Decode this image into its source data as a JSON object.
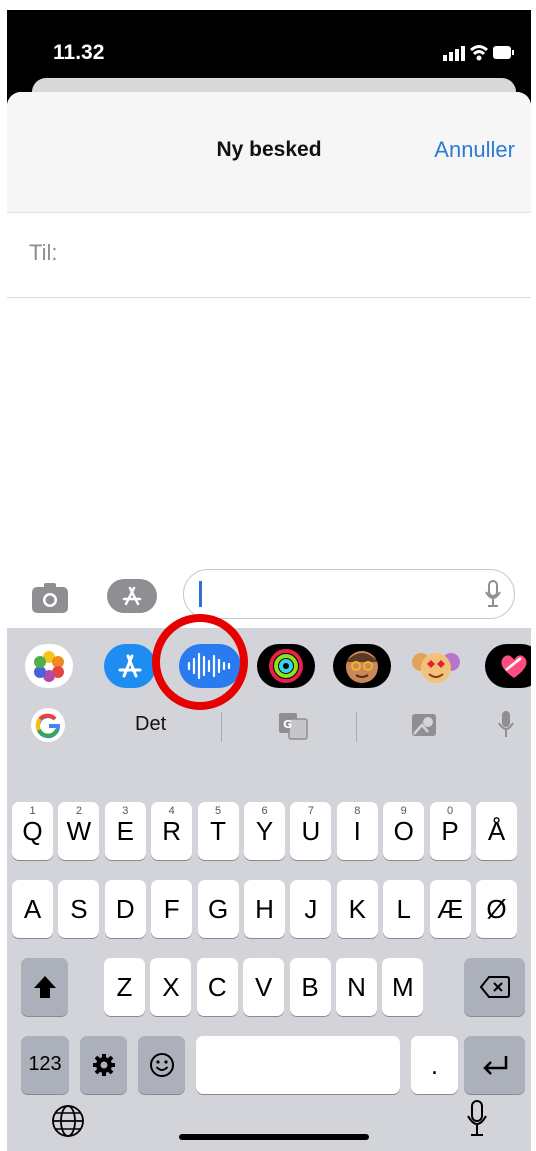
{
  "status_bar": {
    "time": "11.32"
  },
  "header": {
    "title": "Ny besked",
    "cancel_label": "Annuller"
  },
  "recipient": {
    "label": "Til:"
  },
  "app_strip": [
    "photos-icon",
    "appstore-icon",
    "audio-message-icon",
    "activity-icon",
    "memoji-icon",
    "animoji-icon",
    "digital-touch-icon"
  ],
  "prediction": {
    "word": "Det"
  },
  "keyboard": {
    "row1": [
      {
        "k": "Q",
        "n": "1"
      },
      {
        "k": "W",
        "n": "2"
      },
      {
        "k": "E",
        "n": "3"
      },
      {
        "k": "R",
        "n": "4"
      },
      {
        "k": "T",
        "n": "5"
      },
      {
        "k": "Y",
        "n": "6"
      },
      {
        "k": "U",
        "n": "7"
      },
      {
        "k": "I",
        "n": "8"
      },
      {
        "k": "O",
        "n": "9"
      },
      {
        "k": "P",
        "n": "0"
      },
      {
        "k": "Å",
        "n": ""
      }
    ],
    "row2": [
      "A",
      "S",
      "D",
      "F",
      "G",
      "H",
      "J",
      "K",
      "L",
      "Æ",
      "Ø"
    ],
    "row3": [
      "Z",
      "X",
      "C",
      "V",
      "B",
      "N",
      "M"
    ],
    "numbers_label": "123",
    "period_label": "."
  },
  "colors": {
    "accent": "#2d7bd4",
    "highlight_circle": "#e60000"
  }
}
